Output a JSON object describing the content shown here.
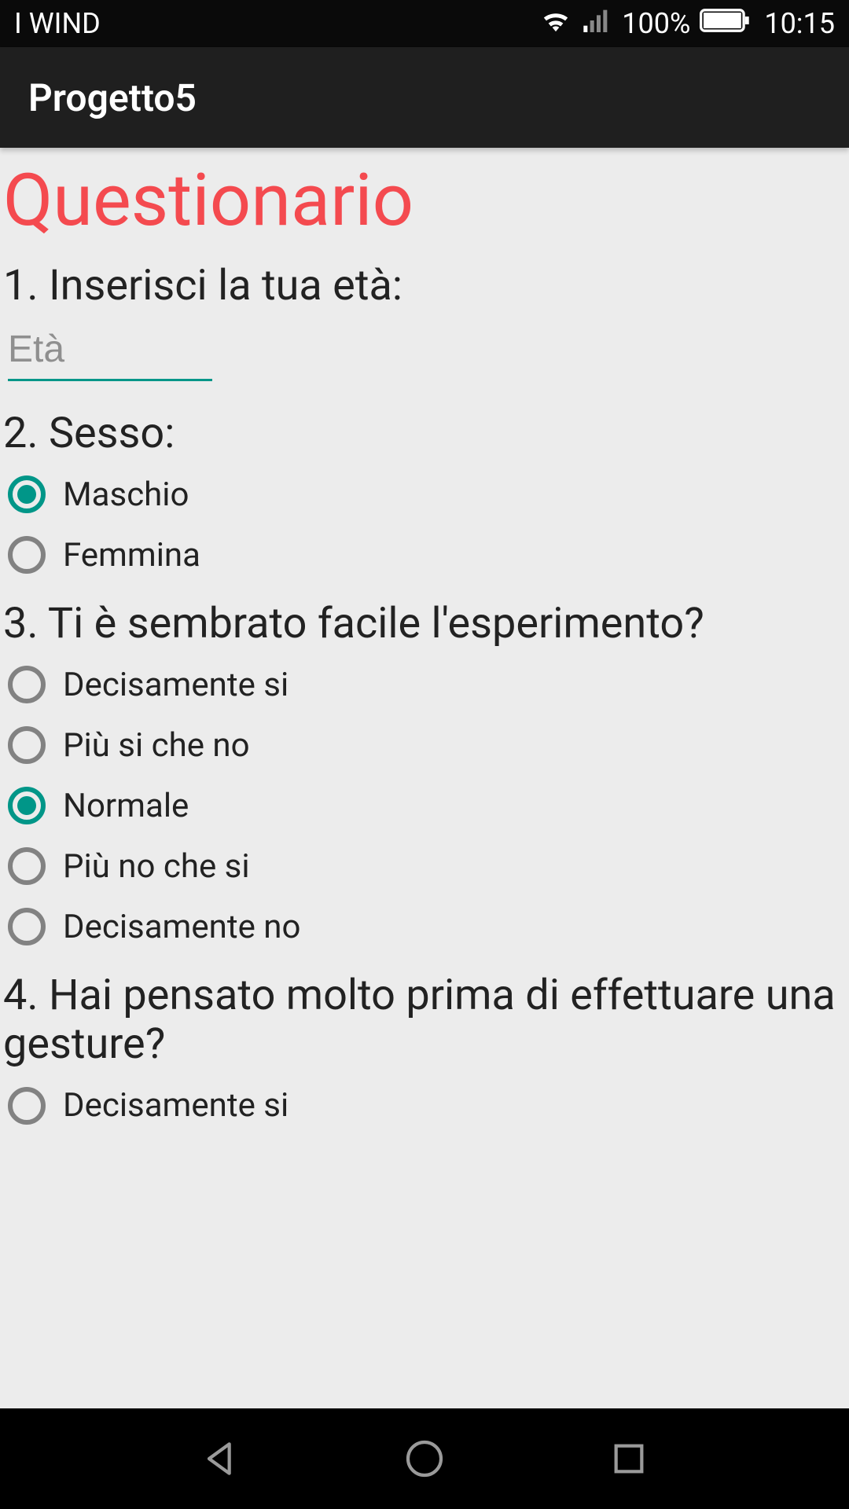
{
  "status_bar": {
    "carrier": "I WIND",
    "battery_pct": "100%",
    "clock": "10:15"
  },
  "app_bar": {
    "title": "Progetto5"
  },
  "page": {
    "title": "Questionario"
  },
  "questions": [
    {
      "label": "1. Inserisci la tua età:",
      "type": "text",
      "placeholder": "Età",
      "value": ""
    },
    {
      "label": "2. Sesso:",
      "type": "radio",
      "options": [
        {
          "label": "Maschio",
          "selected": true
        },
        {
          "label": "Femmina",
          "selected": false
        }
      ]
    },
    {
      "label": "3. Ti è sembrato facile l'esperimento?",
      "type": "radio",
      "options": [
        {
          "label": "Decisamente si",
          "selected": false
        },
        {
          "label": "Più si che no",
          "selected": false
        },
        {
          "label": "Normale",
          "selected": true
        },
        {
          "label": "Più no che si",
          "selected": false
        },
        {
          "label": "Decisamente no",
          "selected": false
        }
      ]
    },
    {
      "label": "4. Hai pensato molto prima di effettuare una gesture?",
      "type": "radio",
      "options": [
        {
          "label": "Decisamente si",
          "selected": false
        }
      ]
    }
  ],
  "colors": {
    "accent": "#009688",
    "title": "#f44a4f"
  }
}
